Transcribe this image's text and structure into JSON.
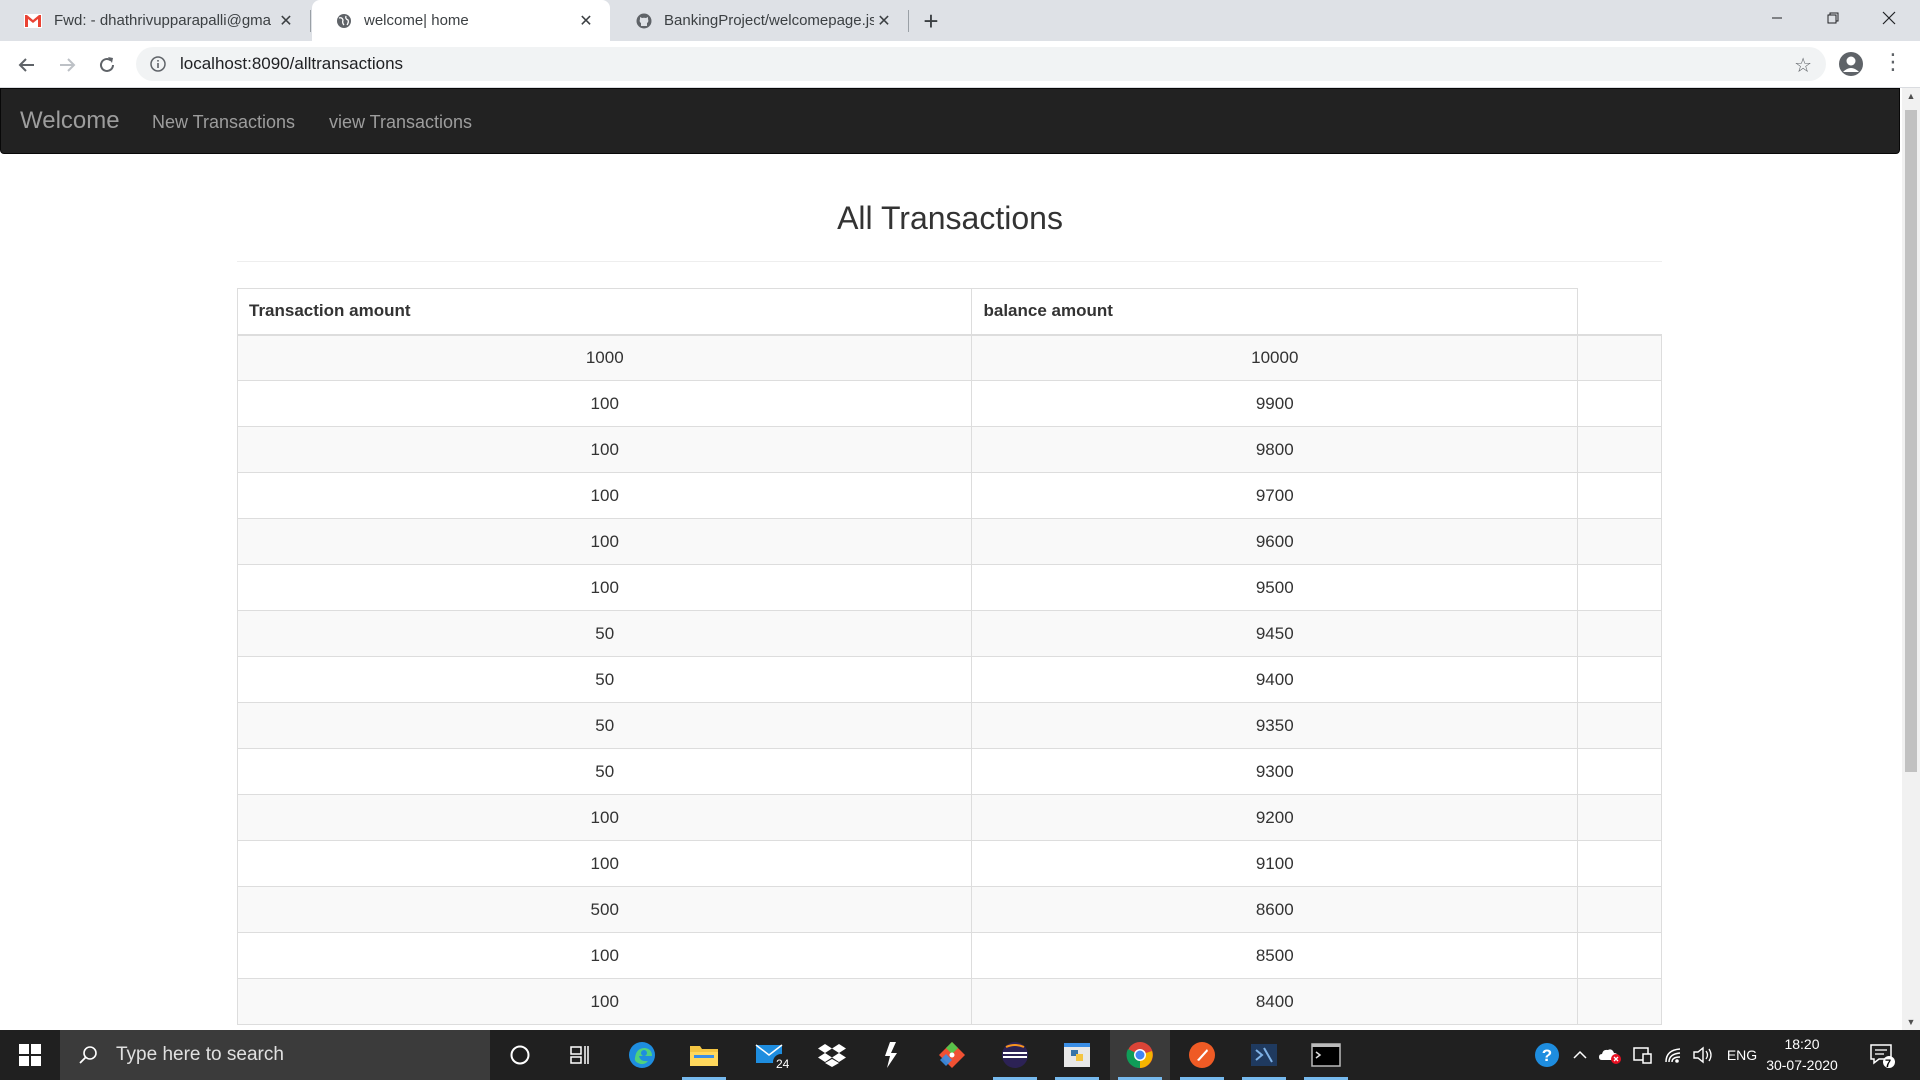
{
  "browser": {
    "tabs": [
      {
        "title": "Fwd: - dhathrivupparapalli@gma",
        "icon": "gmail-icon",
        "active": false
      },
      {
        "title": "welcome| home",
        "icon": "globe-icon",
        "active": true
      },
      {
        "title": "BankingProject/welcomepage.jsp",
        "icon": "github-icon",
        "active": false
      }
    ],
    "new_tab": "+",
    "url": "localhost:8090/alltransactions"
  },
  "navbar": {
    "brand": "Welcome",
    "links": [
      "New Transactions",
      "view Transactions"
    ]
  },
  "page": {
    "heading": "All Transactions",
    "table": {
      "headers": [
        "Transaction amount",
        "balance amount"
      ],
      "rows": [
        [
          "1000",
          "10000"
        ],
        [
          "100",
          "9900"
        ],
        [
          "100",
          "9800"
        ],
        [
          "100",
          "9700"
        ],
        [
          "100",
          "9600"
        ],
        [
          "100",
          "9500"
        ],
        [
          "50",
          "9450"
        ],
        [
          "50",
          "9400"
        ],
        [
          "50",
          "9350"
        ],
        [
          "50",
          "9300"
        ],
        [
          "100",
          "9200"
        ],
        [
          "100",
          "9100"
        ],
        [
          "500",
          "8600"
        ],
        [
          "100",
          "8500"
        ],
        [
          "100",
          "8400"
        ]
      ]
    }
  },
  "taskbar": {
    "search_placeholder": "Type here to search",
    "mail_badge": "24",
    "language": "ENG",
    "time": "18:20",
    "date": "30-07-2020",
    "notification_count": "7",
    "accent": "#76b9ed"
  },
  "colors": {
    "navbar_bg": "#222222",
    "navbar_text": "#9d9d9d",
    "stripe_row": "#f9f9f9",
    "table_border": "#dddddd"
  }
}
